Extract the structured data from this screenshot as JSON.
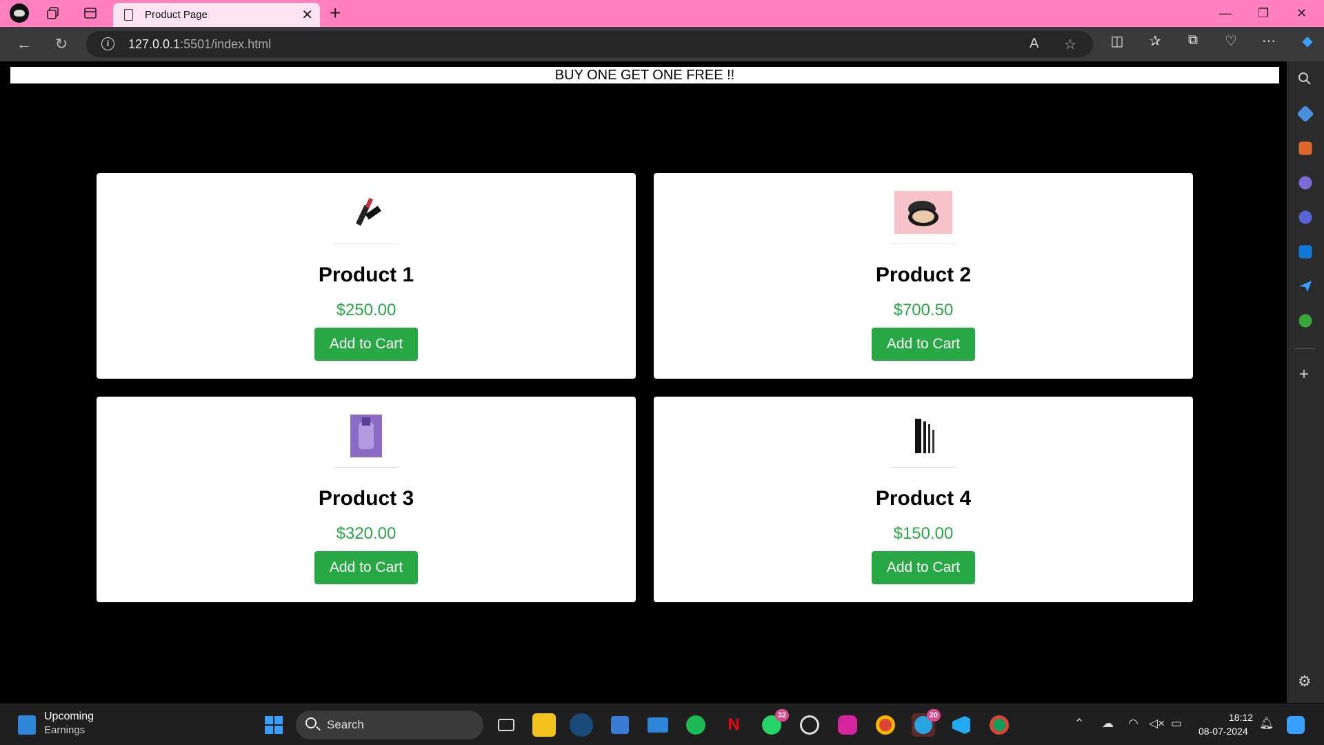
{
  "browser": {
    "tab_title": "Product Page",
    "url_host": "127.0.0.1",
    "url_path": ":5501/index.html"
  },
  "page": {
    "banner": "BUY ONE GET ONE FREE !!",
    "products": [
      {
        "name": "Product 1",
        "price": "$250.00",
        "button": "Add to Cart",
        "image": "lipstick-image"
      },
      {
        "name": "Product 2",
        "price": "$700.50",
        "button": "Add to Cart",
        "image": "compact-powder-image"
      },
      {
        "name": "Product 3",
        "price": "$320.00",
        "button": "Add to Cart",
        "image": "nail-polish-image"
      },
      {
        "name": "Product 4",
        "price": "$150.00",
        "button": "Add to Cart",
        "image": "eyeliner-image"
      }
    ]
  },
  "taskbar": {
    "widget_title": "Upcoming",
    "widget_subtitle": "Earnings",
    "search_label": "Search",
    "whatsapp_badge": "32",
    "telegram_badge": "20",
    "time": "18:12",
    "date": "08-07-2024"
  },
  "colors": {
    "accent_green": "#28a745",
    "titlebar_pink": "#ff7fbf"
  }
}
